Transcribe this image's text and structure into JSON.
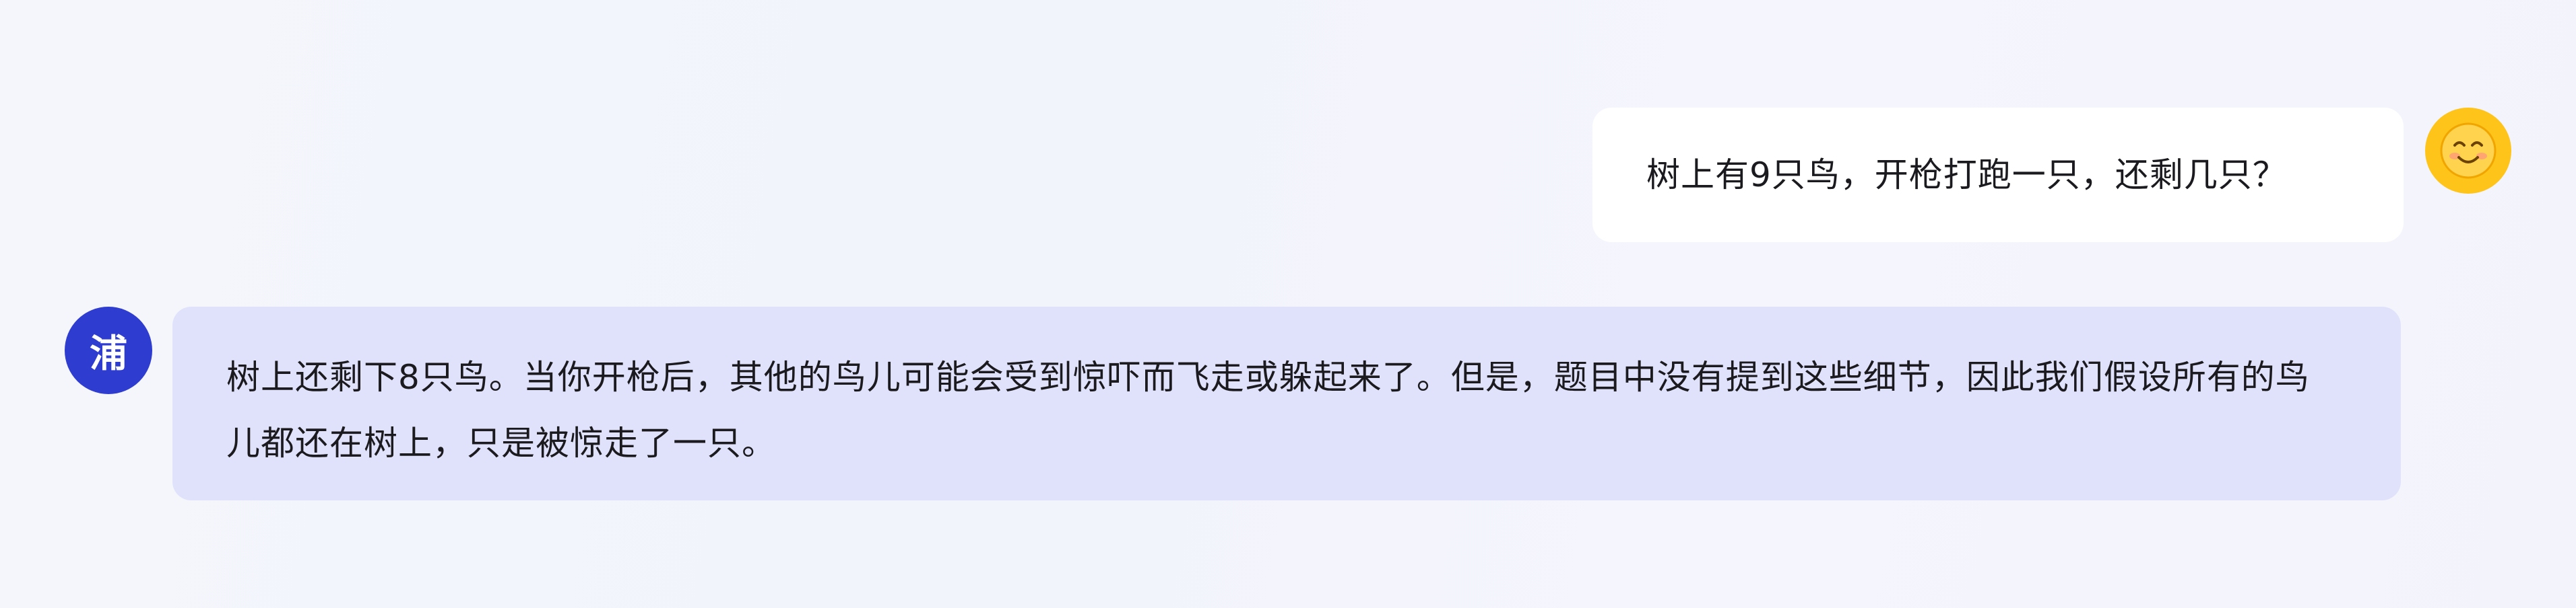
{
  "conversation": {
    "messages": [
      {
        "role": "user",
        "avatar_icon": "smiling-face-emoji",
        "text": "树上有9只鸟，开枪打跑一只，还剩几只？"
      },
      {
        "role": "assistant",
        "avatar_label": "浦",
        "text": "树上还剩下8只鸟。当你开枪后，其他的鸟儿可能会受到惊吓而飞走或躲起来了。但是，题目中没有提到这些细节，因此我们假设所有的鸟儿都还在树上，只是被惊走了一只。"
      }
    ]
  },
  "colors": {
    "page_background": "#f3f5fc",
    "user_bubble": "#ffffff",
    "assistant_bubble": "#e0e2fb",
    "assistant_avatar": "#2f3cd0",
    "user_avatar": "#ffc41a",
    "text": "#1b1b1f"
  }
}
